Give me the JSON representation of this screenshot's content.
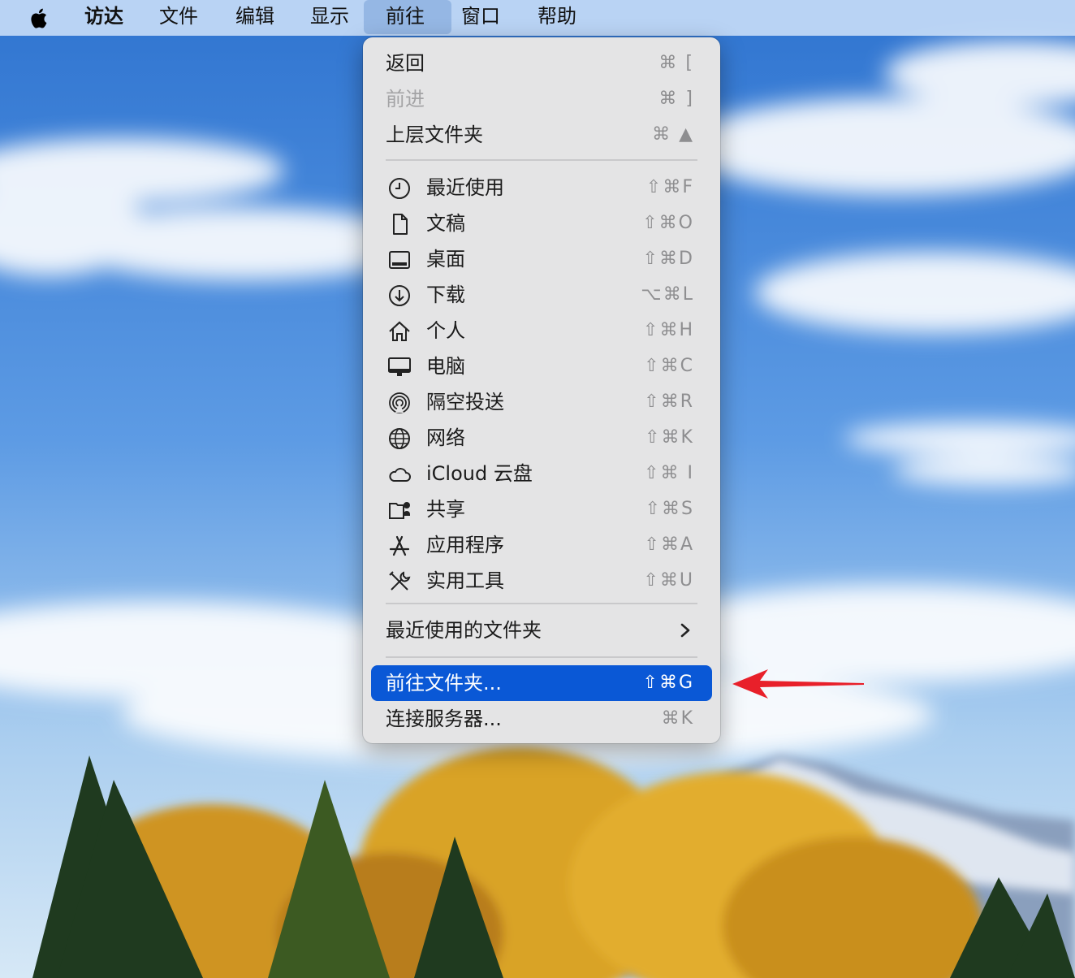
{
  "menubar": {
    "items": [
      {
        "label": "访达"
      },
      {
        "label": "文件"
      },
      {
        "label": "编辑"
      },
      {
        "label": "显示"
      },
      {
        "label": "前往"
      },
      {
        "label": "窗口"
      },
      {
        "label": "帮助"
      }
    ],
    "active_item": "前往"
  },
  "go_menu": {
    "nav": [
      {
        "label": "返回",
        "shortcut": "⌘ ["
      },
      {
        "label": "前进",
        "shortcut": "⌘ ]",
        "disabled": true
      },
      {
        "label": "上层文件夹",
        "shortcut": "⌘ ▲"
      }
    ],
    "places": [
      {
        "label": "最近使用",
        "shortcut": "⇧⌘F",
        "icon": "clock-icon"
      },
      {
        "label": "文稿",
        "shortcut": "⇧⌘O",
        "icon": "document-icon"
      },
      {
        "label": "桌面",
        "shortcut": "⇧⌘D",
        "icon": "desktop-icon"
      },
      {
        "label": "下载",
        "shortcut": "⌥⌘L",
        "icon": "download-icon"
      },
      {
        "label": "个人",
        "shortcut": "⇧⌘H",
        "icon": "home-icon"
      },
      {
        "label": "电脑",
        "shortcut": "⇧⌘C",
        "icon": "computer-icon"
      },
      {
        "label": "隔空投送",
        "shortcut": "⇧⌘R",
        "icon": "airdrop-icon"
      },
      {
        "label": "网络",
        "shortcut": "⇧⌘K",
        "icon": "globe-icon"
      },
      {
        "label": "iCloud 云盘",
        "shortcut": "⇧⌘ I",
        "icon": "cloud-icon"
      },
      {
        "label": "共享",
        "shortcut": "⇧⌘S",
        "icon": "shared-folder-icon"
      },
      {
        "label": "应用程序",
        "shortcut": "⇧⌘A",
        "icon": "applications-icon"
      },
      {
        "label": "实用工具",
        "shortcut": "⇧⌘U",
        "icon": "utilities-icon"
      }
    ],
    "recent_folders": {
      "label": "最近使用的文件夹",
      "icon": "chevron-right-icon"
    },
    "go_to_folder": {
      "label": "前往文件夹...",
      "shortcut": "⇧⌘G",
      "highlighted": true
    },
    "connect_server": {
      "label": "连接服务器...",
      "shortcut": "⌘K"
    }
  },
  "colors": {
    "highlight": "#0a58d6",
    "annotation_arrow": "#e8202a"
  }
}
